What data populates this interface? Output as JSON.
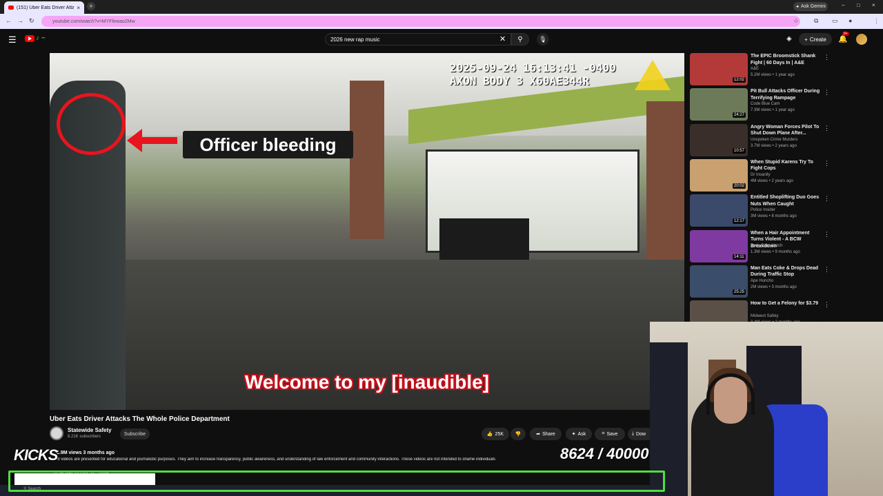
{
  "browser": {
    "tab_title": "(151) Uber Eats Driver Attack",
    "tab_close": "×",
    "new_tab": "+",
    "ask_gemini": "Ask Gemini",
    "url": "youtube.com/watch?v=MYFlewao2Mw",
    "window_controls": [
      "–",
      "□",
      "×"
    ]
  },
  "header": {
    "search_query": "2026 new rap music",
    "create_label": "Create",
    "notification_badge": "9+"
  },
  "player": {
    "timestamp_line1": "2025-09-24 16:13:41 -0400",
    "timestamp_line2": "AXON BODY 3 X60AE344R",
    "overlay_label": "Officer bleeding",
    "subtitle": "Welcome to my [inaudible]"
  },
  "video": {
    "title": "Uber Eats Driver Attacks The Whole Police Department",
    "channel": "Statewide Safety",
    "subscribers": "8.21K subscribers",
    "subscribe_label": "Subscribe",
    "likes": "25K",
    "share_label": "Share",
    "ask_label": "Ask",
    "save_label": "Save",
    "download_label": "Dow",
    "views_line": "1.9M views  3 months ago",
    "description": "All videos are presented for educational and journalistic purposes. They aim to increase transparency, public awareness, and understanding of law enforcement and community interactions. These videos are not intended to shame individuals",
    "description_more": "REMOVAL REQUEST ...more"
  },
  "recommendations": [
    {
      "title": "The EPIC Broomstick Shank Fight | 60 Days In | A&E",
      "channel": "A&E",
      "meta": "5.2M views • 1 year ago",
      "duration": "12:02",
      "color": "#b43a3a"
    },
    {
      "title": "Pit Bull Attacks Officer During Terrifying Rampage",
      "channel": "Code Blue Cam",
      "meta": "7.3M views • 1 year ago",
      "duration": "24:27",
      "color": "#6d7a5a"
    },
    {
      "title": "Angry Woman Forces Pilot To Shut Down Plane After...",
      "channel": "Unspoken Crime Murders",
      "meta": "3.7M views • 2 years ago",
      "duration": "10:57",
      "color": "#3a2e2a"
    },
    {
      "title": "When Stupid Karens Try To Fight Cops",
      "channel": "Dr Insanity",
      "meta": "4M views • 2 years ago",
      "duration": "20:02",
      "color": "#c9a070"
    },
    {
      "title": "Entitled Shoplifting Duo Goes Nuts When Caught",
      "channel": "Police Insider",
      "meta": "3M views • 8 months ago",
      "duration": "12:17",
      "color": "#3b4a6a"
    },
    {
      "title": "When a Hair Appointment Turns Violent - A BCW Breakdown",
      "channel": "Body Cam Watch",
      "meta": "1.3M views • 9 months ago",
      "duration": "14:11",
      "color": "#7e3aa0"
    },
    {
      "title": "Man Eats Coke & Drops Dead During Traffic Stop",
      "channel": "Ape Huncho",
      "meta": "2M views • 3 months ago",
      "duration": "25:25",
      "color": "#3a4d6a"
    },
    {
      "title": "How to Get a Felony for $3.79",
      "channel": "Midwest Safety",
      "meta": "3.4M views • 2 months ago",
      "duration": "",
      "color": "#5a5048"
    }
  ],
  "overlay": {
    "kicks_label": "KICKS",
    "counter_text": "8624 / 40000",
    "goal_current": 8624,
    "goal_target": 40000
  },
  "taskbar": {
    "search_text": "Search"
  },
  "icons": {
    "menu": "hamburger-icon",
    "search": "search-icon",
    "mic": "mic-icon",
    "bell": "bell-icon",
    "like": "thumbs-up-icon",
    "dislike": "thumbs-down-icon"
  },
  "colors": {
    "accent_red": "#ff0000",
    "progress_green": "#4ee03e",
    "address_bar": "#f5a5f5"
  }
}
